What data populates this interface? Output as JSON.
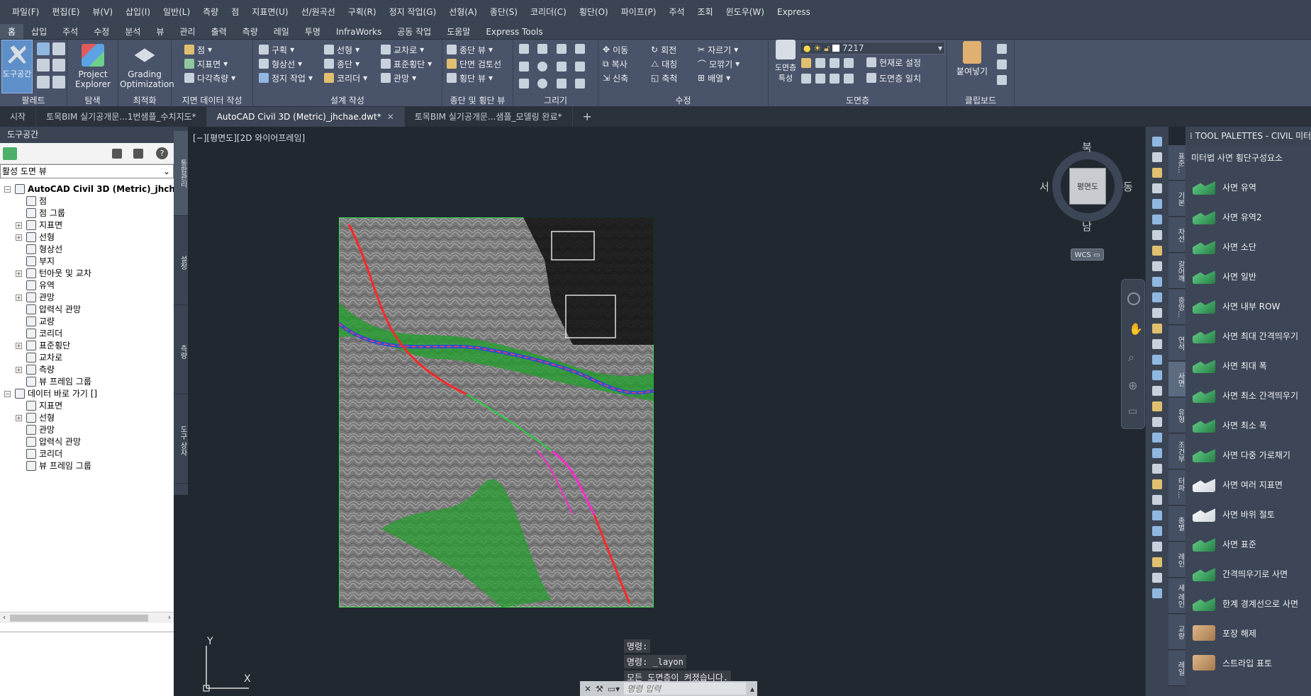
{
  "menu": [
    "파일(F)",
    "편집(E)",
    "뷰(V)",
    "삽입(I)",
    "일반(L)",
    "측량",
    "점",
    "지표면(U)",
    "선/원곡선",
    "구획(R)",
    "정지 작업(G)",
    "선형(A)",
    "종단(S)",
    "코리더(C)",
    "횡단(O)",
    "파이프(P)",
    "주석",
    "조회",
    "윈도우(W)",
    "Express"
  ],
  "ribbon_tabs": [
    "홈",
    "삽입",
    "주석",
    "수정",
    "분석",
    "뷰",
    "관리",
    "출력",
    "측량",
    "레일",
    "투명",
    "InfraWorks",
    "공동 작업",
    "도움말",
    "Express Tools"
  ],
  "ribbon": {
    "palettes": {
      "toolspace": "도구공간",
      "title": "팔레트"
    },
    "explore": {
      "project_explorer": "Project Explorer",
      "title": "탐색"
    },
    "optimize": {
      "grading": "Grading Optimization",
      "title": "최적화"
    },
    "ground": {
      "point": "점",
      "surface": "지표면",
      "traverse": "다각측량",
      "title": "지면 데이터 작성"
    },
    "design": {
      "parcel": "구획",
      "featureline": "형상선",
      "grading": "정지 작업",
      "alignment": "선형",
      "profile": "종단",
      "corridor": "코리더",
      "intersection": "교차로",
      "assembly": "표준횡단",
      "pipe": "관망",
      "title": "설계 작성"
    },
    "profile_section": {
      "profile_view": "종단 뷰",
      "section_review": "단면 검토선",
      "section_view": "횡단 뷰",
      "title": "종단 및 횡단 뷰"
    },
    "draw": {
      "title": "그리기"
    },
    "modify": {
      "move": "이동",
      "rotate": "회전",
      "trim": "자르기",
      "copy": "복사",
      "mirror": "대칭",
      "fillet": "모깎기",
      "stretch": "신축",
      "scale": "축척",
      "array": "배열",
      "title": "수정"
    },
    "layers": {
      "layer_props": "도면층 특성",
      "layer_value": "7217",
      "make_current": "현재로 설정",
      "match": "도면층 일치",
      "title": "도면층"
    },
    "clipboard": {
      "paste": "붙여넣기",
      "title": "클립보드"
    }
  },
  "doc_tabs": [
    {
      "label": "시작"
    },
    {
      "label": "토목BIM 실기공개문...1번샘플_수치지도*"
    },
    {
      "label": "AutoCAD Civil 3D (Metric)_jhchae.dwt*",
      "active": true
    },
    {
      "label": "토목BIM 실기공개문...샘플_모델링 완료*"
    }
  ],
  "toolspace": {
    "header": "도구공간",
    "view_select": "활성 도면 뷰",
    "tree": [
      {
        "label": "AutoCAD Civil 3D (Metric)_jhchae",
        "level": 0,
        "exp": "−",
        "bold": true
      },
      {
        "label": "점",
        "level": 1
      },
      {
        "label": "점 그룹",
        "level": 1
      },
      {
        "label": "지표면",
        "level": 1,
        "exp": "+"
      },
      {
        "label": "선형",
        "level": 1,
        "exp": "+"
      },
      {
        "label": "형상선",
        "level": 1
      },
      {
        "label": "부지",
        "level": 1
      },
      {
        "label": "턴아웃 및 교차",
        "level": 1,
        "exp": "+"
      },
      {
        "label": "유역",
        "level": 1
      },
      {
        "label": "관망",
        "level": 1,
        "exp": "+"
      },
      {
        "label": "압력식 관망",
        "level": 1
      },
      {
        "label": "교량",
        "level": 1
      },
      {
        "label": "코리더",
        "level": 1
      },
      {
        "label": "표준횡단",
        "level": 1,
        "exp": "+"
      },
      {
        "label": "교차로",
        "level": 1
      },
      {
        "label": "측량",
        "level": 1,
        "exp": "+"
      },
      {
        "label": "뷰 프레임 그룹",
        "level": 1
      },
      {
        "label": "데이터 바로 가기 []",
        "level": 0,
        "exp": "−"
      },
      {
        "label": "지표면",
        "level": 1
      },
      {
        "label": "선형",
        "level": 1,
        "exp": "+"
      },
      {
        "label": "관망",
        "level": 1
      },
      {
        "label": "압력식 관망",
        "level": 1
      },
      {
        "label": "코리더",
        "level": 1
      },
      {
        "label": "뷰 프레임 그룹",
        "level": 1
      }
    ],
    "side_tabs": [
      "통합관리",
      "설정",
      "측량",
      "도구 상자"
    ]
  },
  "viewport": {
    "label": "[−][평면도][2D 와이어프레임]"
  },
  "viewcube": {
    "top": "평면도",
    "n": "북",
    "s": "남",
    "e": "동",
    "w": "서",
    "wcs": "WCS ▭"
  },
  "ucs": {
    "x": "X",
    "y": "Y"
  },
  "command": {
    "history": [
      "명령:",
      "명령: _layon",
      "모든 도면층이 켜졌습니다."
    ],
    "placeholder": "명령 입력"
  },
  "palette": {
    "title": "TOOL PALETTES - CIVIL 미터법",
    "subtitle": "미터법 사면 횡단구성요소",
    "tabs": [
      "표준...",
      "기본",
      "차선",
      "갈어깨",
      "중앙...",
      "연석",
      "사면",
      "유형",
      "조건부",
      "터파...",
      "종별",
      "레인",
      "세 레인",
      "교량",
      "레일"
    ],
    "active_tab": "사면",
    "items": [
      {
        "label": "사면 유역",
        "icon": "green"
      },
      {
        "label": "사면 유역2",
        "icon": "green"
      },
      {
        "label": "사면 소단",
        "icon": "green"
      },
      {
        "label": "사면 일반",
        "icon": "green"
      },
      {
        "label": "사면 내부 ROW",
        "icon": "green"
      },
      {
        "label": "사면 최대 간격띄우기",
        "icon": "green"
      },
      {
        "label": "사면 최대 폭",
        "icon": "green"
      },
      {
        "label": "사면 최소 간격띄우기",
        "icon": "green"
      },
      {
        "label": "사면 최소 폭",
        "icon": "green"
      },
      {
        "label": "사면 다중 가로채기",
        "icon": "green"
      },
      {
        "label": "사면 여러 지표면",
        "icon": "white"
      },
      {
        "label": "사면 바위 절토",
        "icon": "white"
      },
      {
        "label": "사면 표준",
        "icon": "green"
      },
      {
        "label": "간격띄우기로 사면",
        "icon": "green"
      },
      {
        "label": "한계 경계선으로 사면",
        "icon": "green"
      },
      {
        "label": "포장 해제",
        "icon": "brown"
      },
      {
        "label": "스트라입 표토",
        "icon": "brown"
      }
    ]
  }
}
